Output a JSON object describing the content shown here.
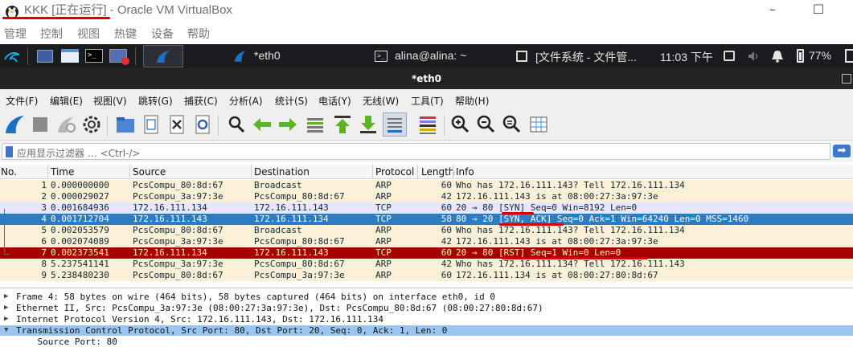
{
  "vbox": {
    "title": "KKK [正在运行] - Oracle VM VirtualBox",
    "minimize": "–",
    "maximize": "☐",
    "menu": [
      "管理",
      "控制",
      "视图",
      "热键",
      "设备",
      "帮助"
    ]
  },
  "guest_panel": {
    "tasks": [
      {
        "label": "*eth0",
        "icon": "wireshark-fin-icon"
      },
      {
        "label": "alina@alina: ~",
        "icon": "terminal-icon"
      },
      {
        "label": "[文件系统 - 文件管...",
        "icon": "file-manager-icon"
      }
    ],
    "clock": "11:03 下午",
    "battery": "77%"
  },
  "wireshark": {
    "title": "*eth0",
    "menu": [
      "文件(F)",
      "编辑(E)",
      "视图(V)",
      "跳转(G)",
      "捕获(C)",
      "分析(A)",
      "统计(S)",
      "电话(Y)",
      "无线(W)",
      "工具(T)",
      "帮助(H)"
    ],
    "filter_placeholder": "应用显示过滤器 … <Ctrl-/>",
    "columns": [
      "No.",
      "Time",
      "Source",
      "Destination",
      "Protocol",
      "Length",
      "Info"
    ],
    "packets": [
      {
        "no": "1",
        "time": "0.000000000",
        "src": "PcsCompu_80:8d:67",
        "dst": "Broadcast",
        "proto": "ARP",
        "len": "60",
        "info": "Who has 172.16.111.143? Tell 172.16.111.134",
        "style": "arp"
      },
      {
        "no": "2",
        "time": "0.000029027",
        "src": "PcsCompu_3a:97:3e",
        "dst": "PcsCompu_80:8d:67",
        "proto": "ARP",
        "len": "42",
        "info": "172.16.111.143 is at 08:00:27:3a:97:3e",
        "style": "arp"
      },
      {
        "no": "3",
        "time": "0.001684936",
        "src": "172.16.111.134",
        "dst": "172.16.111.143",
        "proto": "TCP",
        "len": "60",
        "info": "20 → 80 [SYN] Seq=0 Win=8192 Len=0",
        "style": "tcp"
      },
      {
        "no": "4",
        "time": "0.001712704",
        "src": "172.16.111.143",
        "dst": "172.16.111.134",
        "proto": "TCP",
        "len": "58",
        "info": "80 → 20 [SYN, ACK] Seq=0 Ack=1 Win=64240 Len=0 MSS=1460",
        "style": "sel"
      },
      {
        "no": "5",
        "time": "0.002053579",
        "src": "PcsCompu_80:8d:67",
        "dst": "Broadcast",
        "proto": "ARP",
        "len": "60",
        "info": "Who has 172.16.111.143? Tell 172.16.111.134",
        "style": "arp"
      },
      {
        "no": "6",
        "time": "0.002074089",
        "src": "PcsCompu_3a:97:3e",
        "dst": "PcsCompu_80:8d:67",
        "proto": "ARP",
        "len": "42",
        "info": "172.16.111.143 is at 08:00:27:3a:97:3e",
        "style": "arp"
      },
      {
        "no": "7",
        "time": "0.002373541",
        "src": "172.16.111.134",
        "dst": "172.16.111.143",
        "proto": "TCP",
        "len": "60",
        "info": "20 → 80 [RST] Seq=1 Win=0 Len=0",
        "style": "rst"
      },
      {
        "no": "8",
        "time": "5.237541141",
        "src": "PcsCompu_3a:97:3e",
        "dst": "PcsCompu_80:8d:67",
        "proto": "ARP",
        "len": "42",
        "info": "Who has 172.16.111.134? Tell 172.16.111.143",
        "style": "arp"
      },
      {
        "no": "9",
        "time": "5.238480230",
        "src": "PcsCompu_80:8d:67",
        "dst": "PcsCompu_3a:97:3e",
        "proto": "ARP",
        "len": "60",
        "info": "172.16.111.134 is at 08:00:27:80:8d:67",
        "style": "arp"
      }
    ],
    "details": [
      {
        "arrow": "▶",
        "text": "Frame 4: 58 bytes on wire (464 bits), 58 bytes captured (464 bits) on interface eth0, id 0",
        "sel": false
      },
      {
        "arrow": "▶",
        "text": "Ethernet II, Src: PcsCompu_3a:97:3e (08:00:27:3a:97:3e), Dst: PcsCompu_80:8d:67 (08:00:27:80:8d:67)",
        "sel": false
      },
      {
        "arrow": "▶",
        "text": "Internet Protocol Version 4, Src: 172.16.111.143, Dst: 172.16.111.134",
        "sel": false
      },
      {
        "arrow": "▼",
        "text": "Transmission Control Protocol, Src Port: 80, Dst Port: 20, Seq: 0, Ack: 1, Len: 0",
        "sel": true
      },
      {
        "arrow": "",
        "text": "    Source Port: 80",
        "sel": false
      }
    ]
  },
  "colors": {
    "arp_row": "#faf0d7",
    "tcp_row": "#e7e6ff",
    "selected_row": "#2b7cc3",
    "rst_row": "#a40000",
    "annotation": "#d40000"
  }
}
